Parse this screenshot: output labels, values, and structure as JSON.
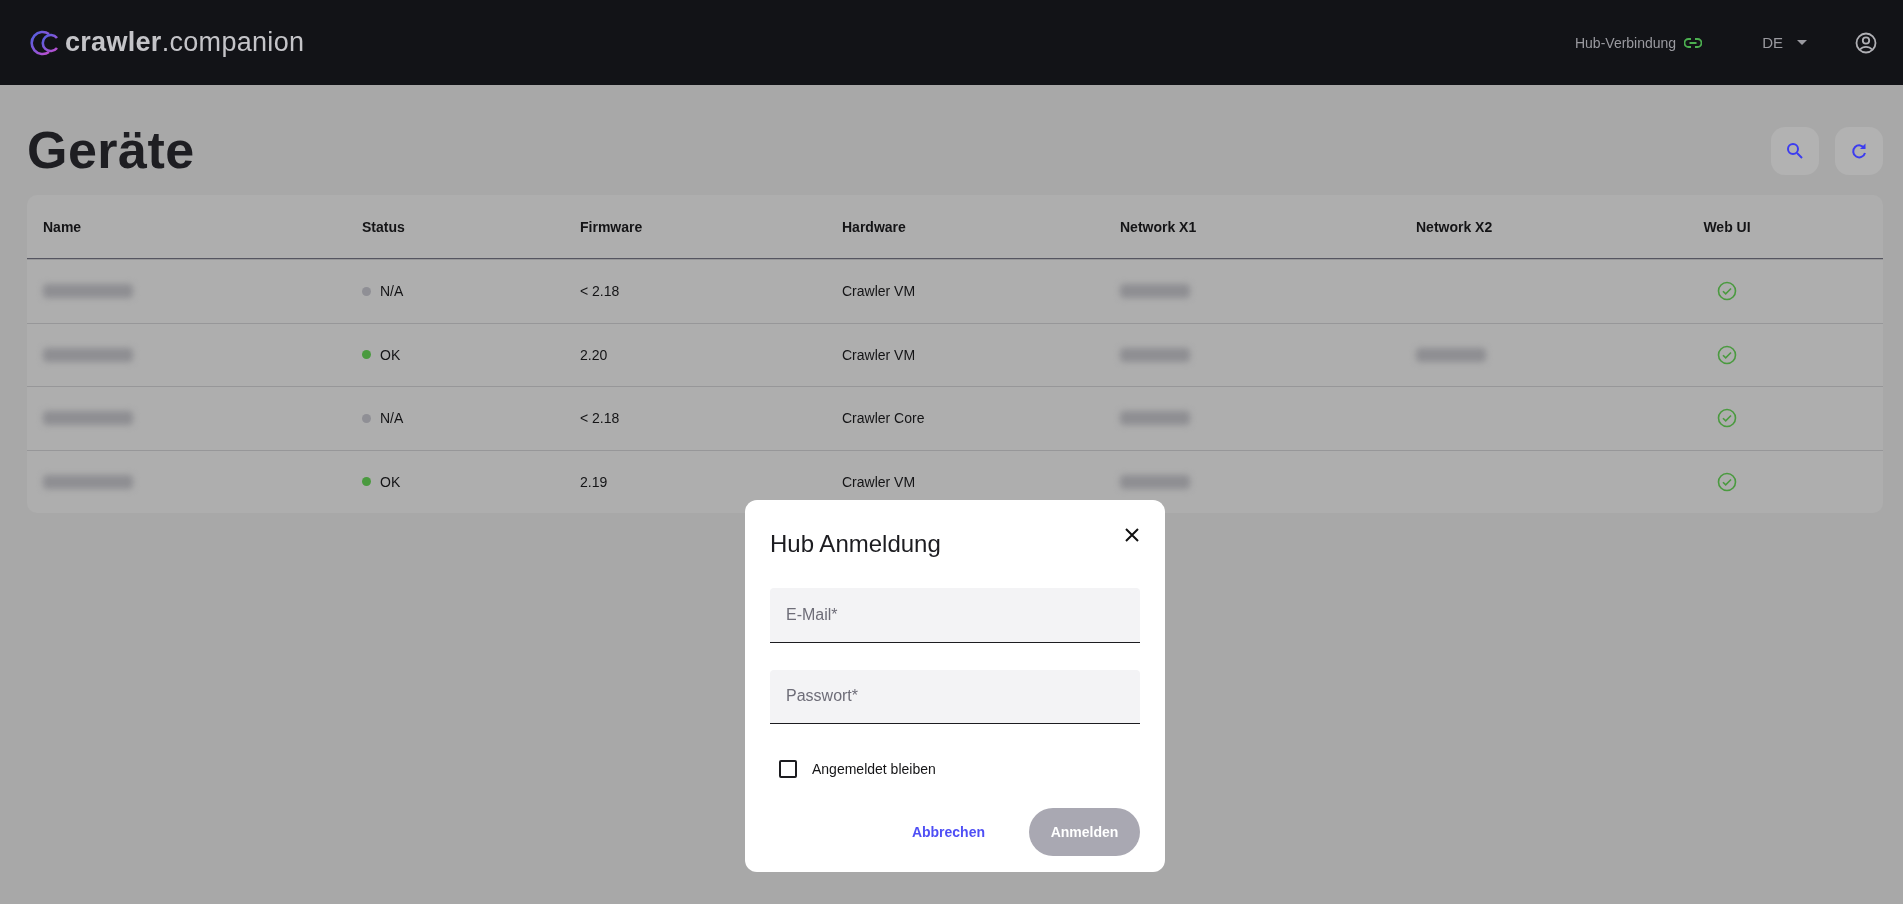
{
  "header": {
    "logo": "**crawler**.companion",
    "hub_connection": {
      "label": "Hub-Verbindung",
      "connected": true
    },
    "language": "DE"
  },
  "page": {
    "title": "Geräte"
  },
  "table": {
    "columns": [
      "Name",
      "Status",
      "Firmware",
      "Hardware",
      "Network X1",
      "Network X2",
      "Web UI"
    ],
    "rows": [
      {
        "name_hidden": true,
        "status": {
          "label": "N/A",
          "color": "#8f8f95"
        },
        "firmware": "< 2.18",
        "hardware": "Crawler VM",
        "x1_hidden": true,
        "web_ui": true
      },
      {
        "name_hidden": true,
        "status": {
          "label": "OK",
          "color": "#4a9a3f"
        },
        "firmware": "2.20",
        "hardware": "Crawler VM",
        "x1_hidden": true,
        "x2_hidden": true,
        "web_ui": true
      },
      {
        "name_hidden": true,
        "status": {
          "label": "N/A",
          "color": "#8f8f95"
        },
        "firmware": "< 2.18",
        "hardware": "Crawler Core",
        "x1_hidden": true,
        "web_ui": true
      },
      {
        "name_hidden": true,
        "status": {
          "label": "OK",
          "color": "#4a9a3f"
        },
        "firmware": "2.19",
        "hardware": "Crawler VM",
        "x1_hidden": true,
        "web_ui": true
      }
    ]
  },
  "dialog": {
    "title": "Hub Anmeldung",
    "fields": [
      {
        "placeholder": "E-Mail*"
      },
      {
        "placeholder": "Passwort*"
      }
    ],
    "remember": {
      "label": "Angemeldet bleiben",
      "checked": false
    },
    "buttons": [
      {
        "label": "Abbrechen",
        "kind": "text",
        "disabled": false
      },
      {
        "label": "Anmelden",
        "kind": "filled",
        "disabled": true
      }
    ]
  }
}
